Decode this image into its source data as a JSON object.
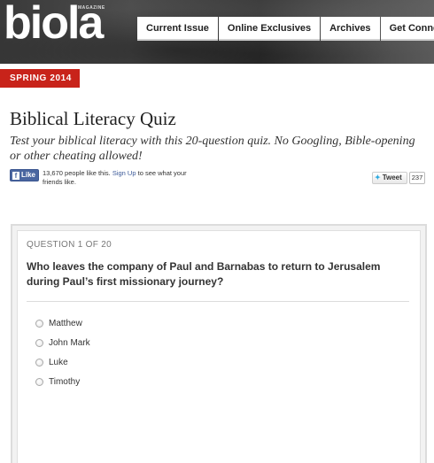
{
  "header": {
    "logo_text": "biola",
    "logo_sub": "MAGAZINE",
    "nav": [
      "Current Issue",
      "Online Exclusives",
      "Archives",
      "Get Connected"
    ]
  },
  "issue_label": "SPRING 2014",
  "article": {
    "title": "Biblical Literacy Quiz",
    "intro": "Test your biblical literacy with this 20-question quiz. No Googling, Bible-opening or other cheating allowed!"
  },
  "social": {
    "fb_like_label": "Like",
    "fb_text_before": "13,670 people like this.",
    "fb_signup": "Sign Up",
    "fb_text_after": "to see what your friends like.",
    "tweet_label": "Tweet",
    "tweet_count": "237"
  },
  "quiz": {
    "counter": "QUESTION 1 OF 20",
    "question": "Who leaves the company of Paul and Barnabas to return to Jerusalem during Paul’s first missionary journey?",
    "options": [
      "Matthew",
      "John Mark",
      "Luke",
      "Timothy"
    ]
  },
  "colors": {
    "accent_red": "#c8231a",
    "facebook_blue": "#4a66a0",
    "twitter_blue": "#2aa9e0"
  }
}
